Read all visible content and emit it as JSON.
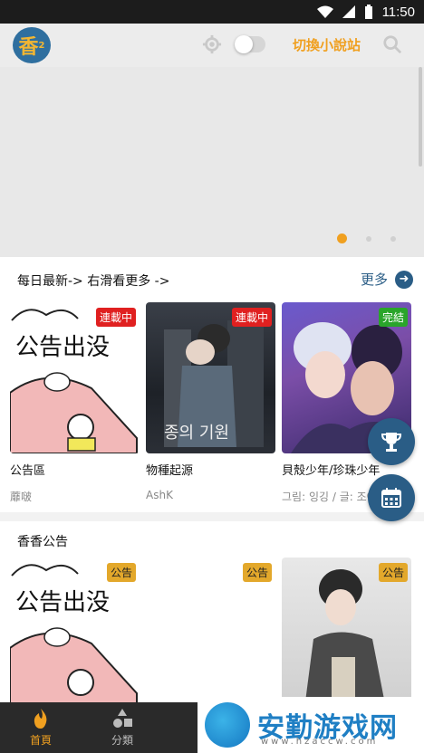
{
  "status_bar": {
    "time": "11:50"
  },
  "header": {
    "logo_text": "香",
    "logo_sup": "2",
    "switch_label": "切換小說站"
  },
  "banner": {
    "pages": 3,
    "active_page": 1
  },
  "daily": {
    "title": "每日最新-> 右滑看更多 ->",
    "more_label": "更多",
    "cards": [
      {
        "title": "公告區",
        "author": "蘼啵",
        "badge": "連載中",
        "badge_color": "#e02020",
        "cover_text": "公告出没"
      },
      {
        "title": "物種起源",
        "author": "AshK",
        "badge": "連載中",
        "badge_color": "#e02020",
        "cover_text": "종의 기원"
      },
      {
        "title": "貝殼少年/珍珠少年",
        "author": "그림: 잉깅 / 글: 조아",
        "badge": "完結",
        "badge_color": "#2aa52a"
      }
    ]
  },
  "notice": {
    "title": "香香公告",
    "cards": [
      {
        "badge": "公告",
        "cover_text": "公告出没"
      },
      {
        "badge": "公告"
      },
      {
        "badge": "公告"
      }
    ]
  },
  "nav": {
    "items": [
      {
        "label": "首頁"
      },
      {
        "label": "分類"
      }
    ]
  },
  "watermark": {
    "text": "安勤游戏网",
    "url": "www.hzaccw.com"
  },
  "colors": {
    "accent": "#f0a020",
    "primary": "#2a5d86"
  }
}
